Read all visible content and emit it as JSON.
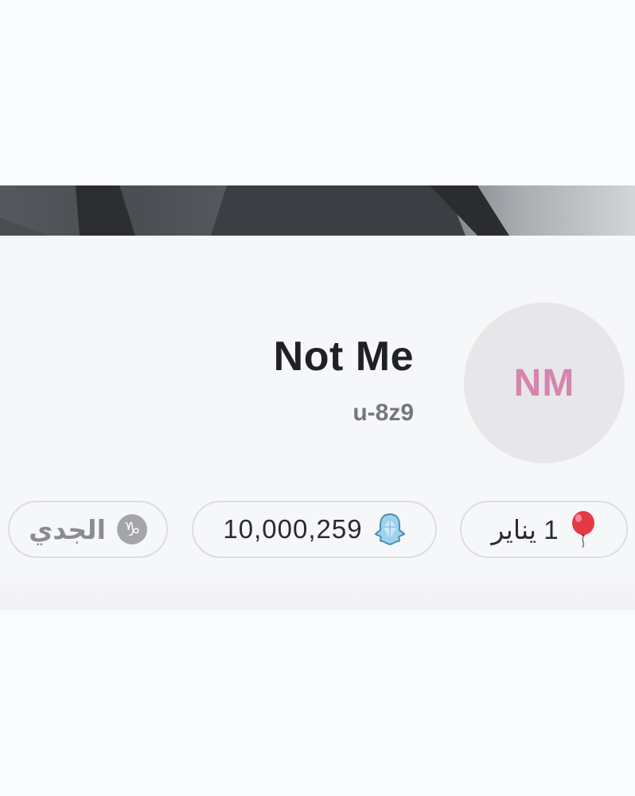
{
  "profile": {
    "initials": "NM",
    "display_name": "Not Me",
    "username": "u-8z9"
  },
  "badges": {
    "birthday": {
      "text": "1 يناير",
      "icon": "balloon-icon"
    },
    "snap_score": {
      "text": "10,000,259",
      "icon": "ghost-icon"
    },
    "zodiac": {
      "text": "الجدي",
      "icon": "capricorn-icon",
      "glyph": "♑"
    }
  },
  "colors": {
    "avatar_background": "#e7e7e9",
    "initials": "#d486ad",
    "balloon": "#e53945"
  }
}
